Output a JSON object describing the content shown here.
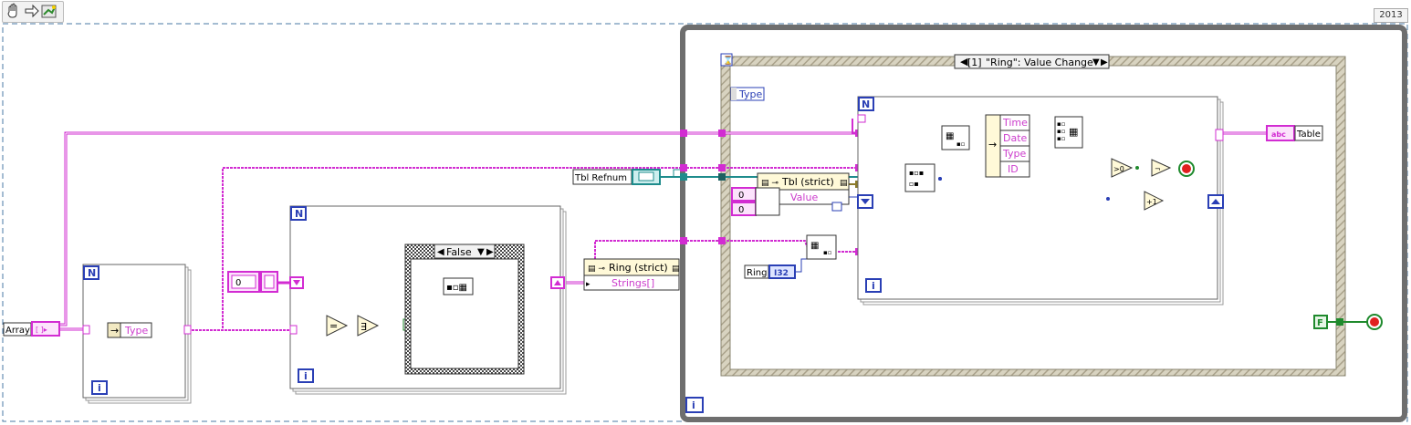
{
  "toolbar": {
    "version": "2013",
    "buttons": [
      "hand-tool-icon",
      "arrow-tool-icon",
      "run-highlight-icon"
    ]
  },
  "terminals": {
    "array_label": "Array",
    "tbl_refnum_label": "Tbl Refnum",
    "ring_label": "Ring",
    "ring_type": "I32",
    "table_label": "Table",
    "table_type": "abc",
    "false_const": "F"
  },
  "loop1": {
    "count": "N",
    "index": "i",
    "unbundle_field": "Type"
  },
  "loop2": {
    "count": "N",
    "index": "i",
    "init_const": "0",
    "case_label": "False",
    "property_node_title": "Ring (strict)",
    "property_node_field": "Strings[]"
  },
  "outer_while": {
    "index": "i"
  },
  "event_structure": {
    "case_index": "[1]",
    "case_label": "\"Ring\": Value Change",
    "event_data": "Type",
    "property_node_title": "Tbl (strict)",
    "property_node_field": "Value",
    "const_row": "0",
    "const_col": "0"
  },
  "inner_for": {
    "count": "N",
    "index": "i",
    "bundle_fields": [
      "Time",
      "Date",
      "Type",
      "ID"
    ],
    "inc_label": "+1"
  },
  "colors": {
    "wire_string": "#d22cd2",
    "wire_numeric": "#2a3fb5",
    "wire_refnum": "#1e8c8c",
    "wire_bool": "#1f8a2d",
    "struct_border": "#808080",
    "while_border": "#6e6e6e"
  }
}
